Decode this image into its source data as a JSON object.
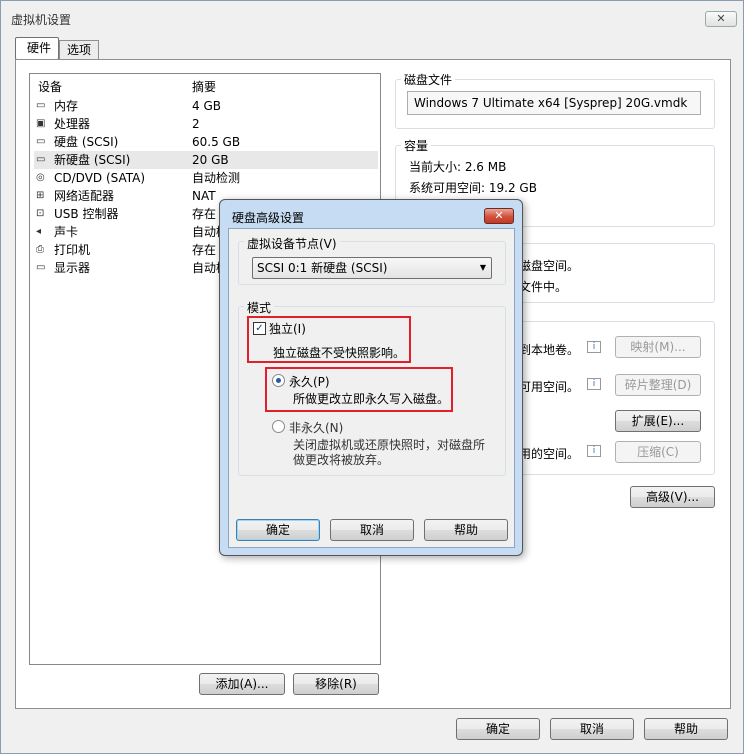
{
  "window": {
    "title": "虚拟机设置",
    "close_glyph": "✕"
  },
  "tabs": [
    {
      "label": "硬件"
    },
    {
      "label": "选项"
    }
  ],
  "device_list": {
    "headers": {
      "device": "设备",
      "summary": "摘要"
    },
    "rows": [
      {
        "name": "内存",
        "summary": "4 GB",
        "icon": "memory-icon"
      },
      {
        "name": "处理器",
        "summary": "2",
        "icon": "processor-icon"
      },
      {
        "name": "硬盘 (SCSI)",
        "summary": "60.5 GB",
        "icon": "harddisk-icon"
      },
      {
        "name": "新硬盘 (SCSI)",
        "summary": "20 GB",
        "icon": "harddisk-icon"
      },
      {
        "name": "CD/DVD (SATA)",
        "summary": "自动检测",
        "icon": "cdrom-icon"
      },
      {
        "name": "网络适配器",
        "summary": "NAT",
        "icon": "network-icon"
      },
      {
        "name": "USB 控制器",
        "summary": "存在",
        "icon": "usb-icon"
      },
      {
        "name": "声卡",
        "summary": "自动检",
        "icon": "sound-icon"
      },
      {
        "name": "打印机",
        "summary": "存在",
        "icon": "printer-icon"
      },
      {
        "name": "显示器",
        "summary": "自动检",
        "icon": "display-icon"
      }
    ]
  },
  "list_buttons": {
    "add": "添加(A)...",
    "remove": "移除(R)"
  },
  "disk_file": {
    "label": "磁盘文件",
    "value": "Windows 7 Ultimate x64 [Sysprep] 20G.vmdk"
  },
  "capacity": {
    "label": "容量",
    "current_size": "当前大小: 2.6 MB",
    "free_space": "系统可用空间: 19.2 GB"
  },
  "alloc_partial": {
    "line1": "磁盘空间。",
    "line2": "文件中。"
  },
  "utilities": {
    "map_text": "到本地卷。",
    "map_button": "映射(M)...",
    "defrag_text": "可用空间。",
    "defrag_button": "碎片整理(D)",
    "expand_button": "扩展(E)...",
    "compact_text": "用的空间。",
    "compact_button": "压缩(C)"
  },
  "advanced_button": "高级(V)...",
  "footer": {
    "ok": "确定",
    "cancel": "取消",
    "help": "帮助"
  },
  "dialog": {
    "title": "硬盘高级设置",
    "close_glyph": "✕",
    "node_label": "虚拟设备节点(V)",
    "node_value": "SCSI 0:1   新硬盘 (SCSI)",
    "mode_label": "模式",
    "independent_label": "独立(I)",
    "independent_desc": "独立磁盘不受快照影响。",
    "persistent_label": "永久(P)",
    "persistent_desc": "所做更改立即永久写入磁盘。",
    "nonpersistent_label": "非永久(N)",
    "nonpersistent_desc1": "关闭虚拟机或还原快照时，对磁盘所",
    "nonpersistent_desc2": "做更改将被放弃。",
    "ok": "确定",
    "cancel": "取消",
    "help": "帮助"
  }
}
